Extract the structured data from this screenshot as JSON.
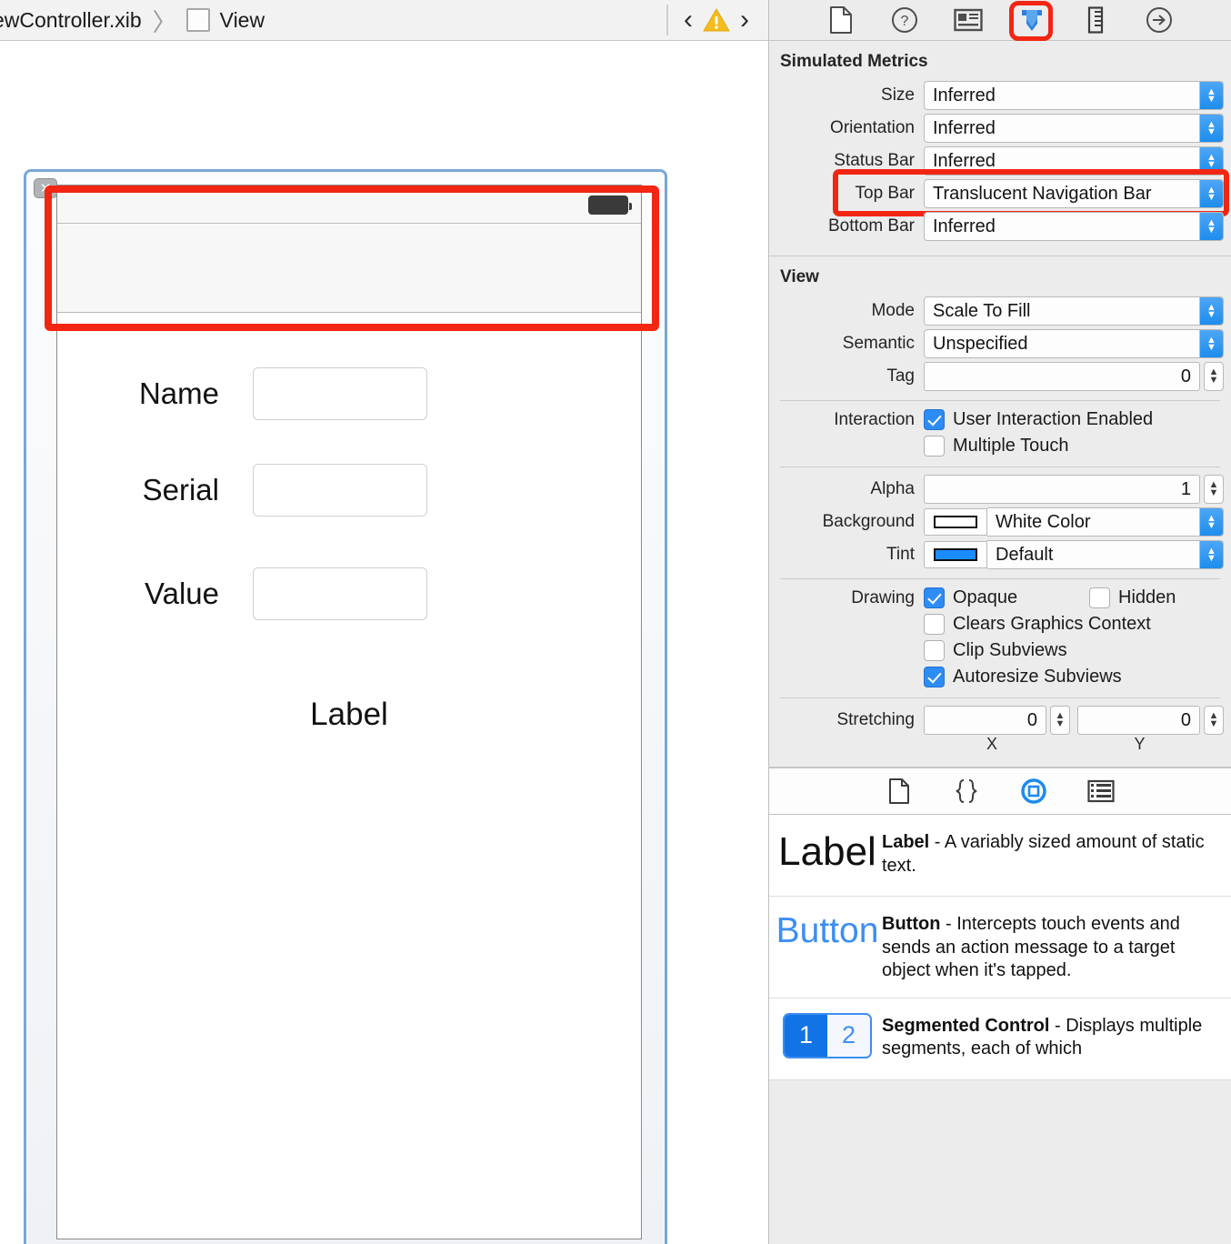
{
  "jumpbar": {
    "breadcrumb_file": "ewController.xib",
    "breadcrumb_separator": "〉",
    "breadcrumb_view": "View",
    "back_chevron": "‹",
    "forward_chevron": "›",
    "warning_icon": "warning-triangle"
  },
  "inspector_tabs": [
    {
      "name": "file-inspector",
      "glyph": "file"
    },
    {
      "name": "quick-help-inspector",
      "glyph": "question"
    },
    {
      "name": "identity-inspector",
      "glyph": "id-card"
    },
    {
      "name": "attributes-inspector",
      "glyph": "down-arrow-shield",
      "selected": true,
      "highlighted": true
    },
    {
      "name": "size-inspector",
      "glyph": "ruler"
    },
    {
      "name": "connections-inspector",
      "glyph": "arrow-right-circle"
    }
  ],
  "simulated_metrics": {
    "title": "Simulated Metrics",
    "rows": [
      {
        "label": "Size",
        "value": "Inferred"
      },
      {
        "label": "Orientation",
        "value": "Inferred"
      },
      {
        "label": "Status Bar",
        "value": "Inferred"
      },
      {
        "label": "Top Bar",
        "value": "Translucent Navigation Bar",
        "highlighted": true
      },
      {
        "label": "Bottom Bar",
        "value": "Inferred"
      }
    ]
  },
  "view_section": {
    "title": "View",
    "mode_label": "Mode",
    "mode_value": "Scale To Fill",
    "semantic_label": "Semantic",
    "semantic_value": "Unspecified",
    "tag_label": "Tag",
    "tag_value": "0",
    "interaction_label": "Interaction",
    "interaction_user_enabled": "User Interaction Enabled",
    "interaction_multiple_touch": "Multiple Touch",
    "alpha_label": "Alpha",
    "alpha_value": "1",
    "background_label": "Background",
    "background_value": "White Color",
    "background_swatch": "#ffffff",
    "tint_label": "Tint",
    "tint_value": "Default",
    "tint_swatch": "#1a8cff",
    "drawing_label": "Drawing",
    "drawing_opaque": "Opaque",
    "drawing_hidden": "Hidden",
    "drawing_clears_graphics": "Clears Graphics Context",
    "drawing_clip_subviews": "Clip Subviews",
    "drawing_autoresize": "Autoresize Subviews",
    "stretching_label": "Stretching",
    "stretching_x": "0",
    "stretching_y": "0",
    "axis_x": "X",
    "axis_y": "Y"
  },
  "library_tabs": [
    {
      "name": "file-template-library",
      "glyph": "file"
    },
    {
      "name": "code-snippet-library",
      "glyph": "braces"
    },
    {
      "name": "object-library",
      "glyph": "circle-square",
      "selected": true
    },
    {
      "name": "media-library",
      "glyph": "filmstrip"
    }
  ],
  "library_items": [
    {
      "icon_text": "Label",
      "icon_style": "plain",
      "title": "Label",
      "description": " - A variably sized amount of static text."
    },
    {
      "icon_text": "Button",
      "icon_style": "blue",
      "title": "Button",
      "description": " - Intercepts touch events and sends an action message to a target object when it's tapped."
    },
    {
      "icon_text": "segmented",
      "icon_style": "segmented",
      "seg_first": "1",
      "seg_second": "2",
      "title": "Segmented Control",
      "description": " - Displays multiple segments, each of which"
    }
  ],
  "canvas": {
    "form_rows": [
      {
        "label": "Name",
        "value": ""
      },
      {
        "label": "Serial",
        "value": ""
      },
      {
        "label": "Value",
        "value": ""
      }
    ],
    "big_label": "Label",
    "selection_badge": "✕",
    "annotation_color": "#f22613"
  }
}
